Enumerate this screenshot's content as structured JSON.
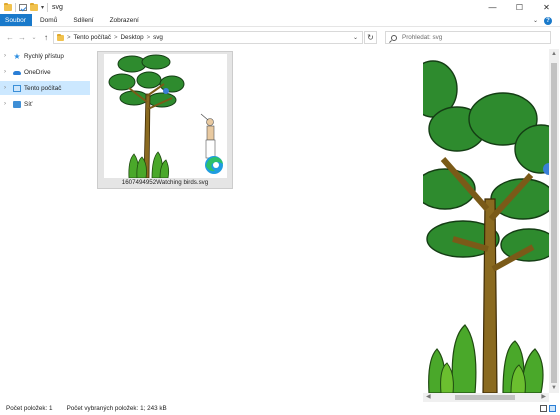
{
  "window": {
    "title": "svg",
    "minimize_glyph": "—",
    "maximize_glyph": "☐",
    "close_glyph": "✕"
  },
  "ribbon": {
    "tabs": [
      "Soubor",
      "Domů",
      "Sdílení",
      "Zobrazení"
    ],
    "accent": "#1979ca"
  },
  "address": {
    "crumbs": [
      "Tento počítač",
      "Desktop",
      "svg"
    ],
    "separator": ">"
  },
  "search": {
    "placeholder": "Prohledat: svg"
  },
  "sidebar": {
    "items": [
      {
        "label": "Rychlý přístup",
        "icon": "star-icon"
      },
      {
        "label": "OneDrive",
        "icon": "cloud-icon"
      },
      {
        "label": "Tento počítač",
        "icon": "computer-icon",
        "selected": true
      },
      {
        "label": "Síť",
        "icon": "network-icon"
      }
    ]
  },
  "files": [
    {
      "name": "1607494952Watching birds.svg",
      "selected": true
    }
  ],
  "status": {
    "count": "Počet položek: 1",
    "selected": "Počet vybraných položek: 1; 243 kB"
  }
}
